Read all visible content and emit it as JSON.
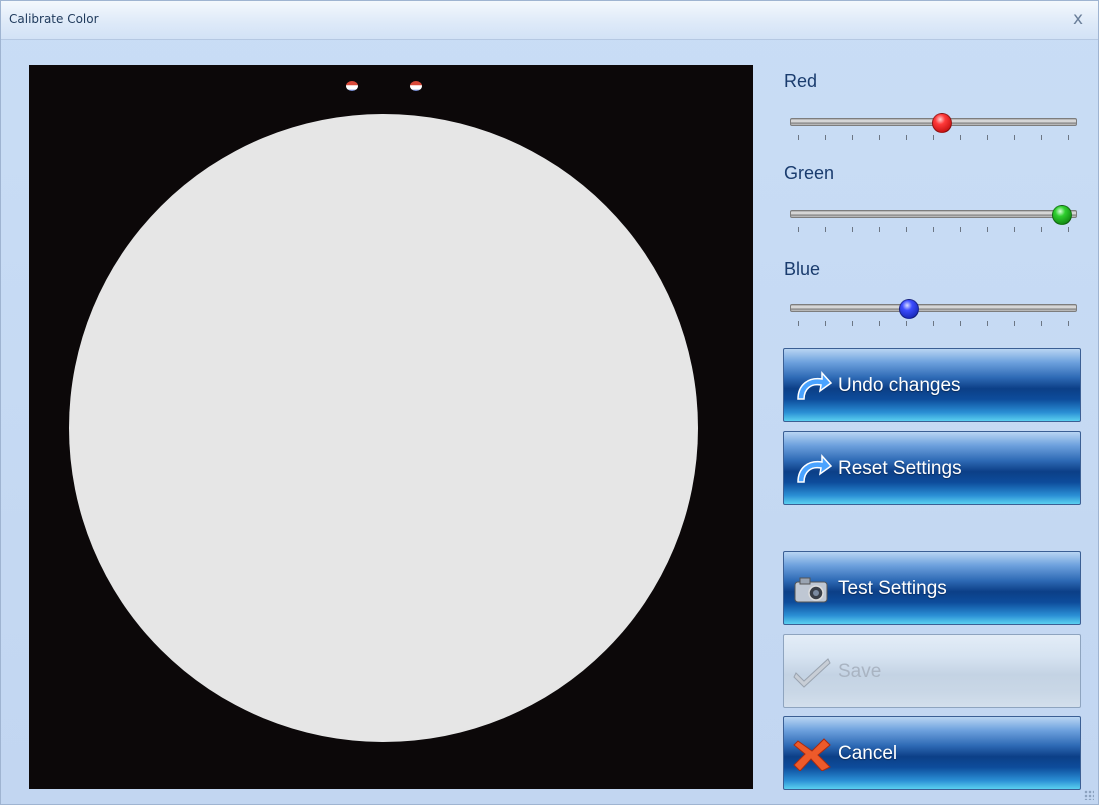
{
  "window": {
    "title": "Calibrate Color",
    "close_glyph": "x"
  },
  "sliders": [
    {
      "label": "Red",
      "value_fraction": 0.53,
      "color": "#e02020"
    },
    {
      "label": "Green",
      "value_fraction": 0.98,
      "color": "#1cae1c"
    },
    {
      "label": "Blue",
      "value_fraction": 0.41,
      "color": "#2233dd"
    }
  ],
  "buttons": {
    "undo": {
      "label": "Undo changes",
      "icon": "undo-arrow-icon"
    },
    "reset": {
      "label": "Reset Settings",
      "icon": "undo-arrow-icon"
    },
    "test": {
      "label": "Test Settings",
      "icon": "camera-icon"
    },
    "save": {
      "label": "Save",
      "icon": "checkmark-icon",
      "enabled": false
    },
    "cancel": {
      "label": "Cancel",
      "icon": "red-x-icon"
    }
  },
  "preview": {
    "background": "#0c0809",
    "disc_color": "#e6e6e6"
  }
}
